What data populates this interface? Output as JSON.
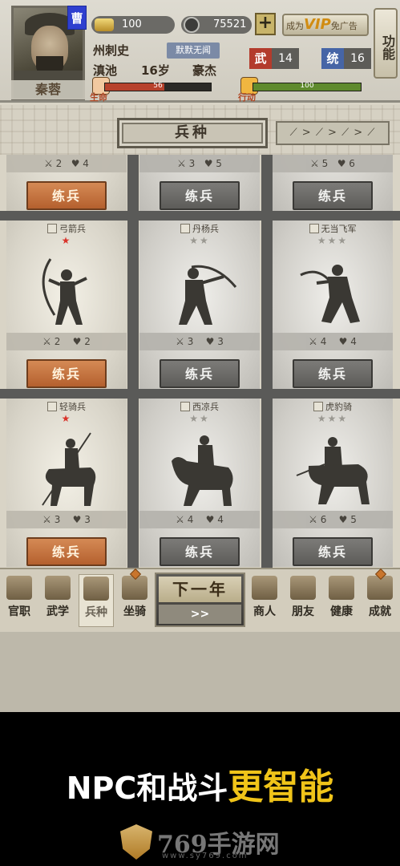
{
  "player": {
    "name": "秦蓉",
    "faction": "曹",
    "title": "州刺史",
    "title_tag": "默默无闻",
    "location": "滇池",
    "age": "16岁",
    "trait": "豪杰"
  },
  "resources": {
    "gold": "100",
    "coins": "75521",
    "plus": "+",
    "vip_prefix": "成为",
    "vip": "VIP",
    "vip_suffix": "免广告",
    "function_label": "功能"
  },
  "attributes": {
    "wu_label": "武",
    "wu_value": "14",
    "tong_label": "统",
    "tong_value": "16"
  },
  "bars": {
    "life_label": "生命",
    "life_value": "56",
    "life_fraction": 0.56,
    "action_label": "行动",
    "action_value": "100",
    "action_fraction": 1.0
  },
  "tab": {
    "title": "兵种",
    "weapon_sequence": "⟋ > ⟋ > ⟋ > ⟋"
  },
  "top_row": {
    "cards": [
      {
        "atk": "2",
        "hp": "4",
        "train": "练兵",
        "active": true
      },
      {
        "atk": "3",
        "hp": "5",
        "train": "练兵",
        "active": false
      },
      {
        "atk": "5",
        "hp": "6",
        "train": "练兵",
        "active": false
      }
    ]
  },
  "units": [
    {
      "name": "弓箭兵",
      "stars": "★",
      "red": true,
      "atk": "2",
      "hp": "2",
      "train": "练兵",
      "active": true
    },
    {
      "name": "丹杨兵",
      "stars": "★★",
      "red": false,
      "atk": "3",
      "hp": "3",
      "train": "练兵",
      "active": false
    },
    {
      "name": "无当飞军",
      "stars": "★★★",
      "red": false,
      "atk": "4",
      "hp": "4",
      "train": "练兵",
      "active": false
    },
    {
      "name": "轻骑兵",
      "stars": "★",
      "red": true,
      "atk": "3",
      "hp": "3",
      "train": "练兵",
      "active": true
    },
    {
      "name": "西凉兵",
      "stars": "★★",
      "red": false,
      "atk": "4",
      "hp": "4",
      "train": "练兵",
      "active": false
    },
    {
      "name": "虎豹骑",
      "stars": "★★★",
      "red": false,
      "atk": "6",
      "hp": "5",
      "train": "练兵",
      "active": false
    }
  ],
  "nav": {
    "items": [
      "官职",
      "武学",
      "兵种",
      "坐骑"
    ],
    "items_right": [
      "商人",
      "朋友",
      "健康",
      "成就"
    ],
    "next_year": "下一年",
    "next_arrow": ">>"
  },
  "promo": {
    "text_white": "NPC和战斗",
    "text_highlight": "更智能",
    "watermark": "769手游网",
    "watermark_url": "www.sy769.com"
  },
  "colors": {
    "active_button": "#c06b38",
    "locked_button": "#6b6a67",
    "highlight": "#f0c419",
    "faction": "#2f3fcf"
  }
}
